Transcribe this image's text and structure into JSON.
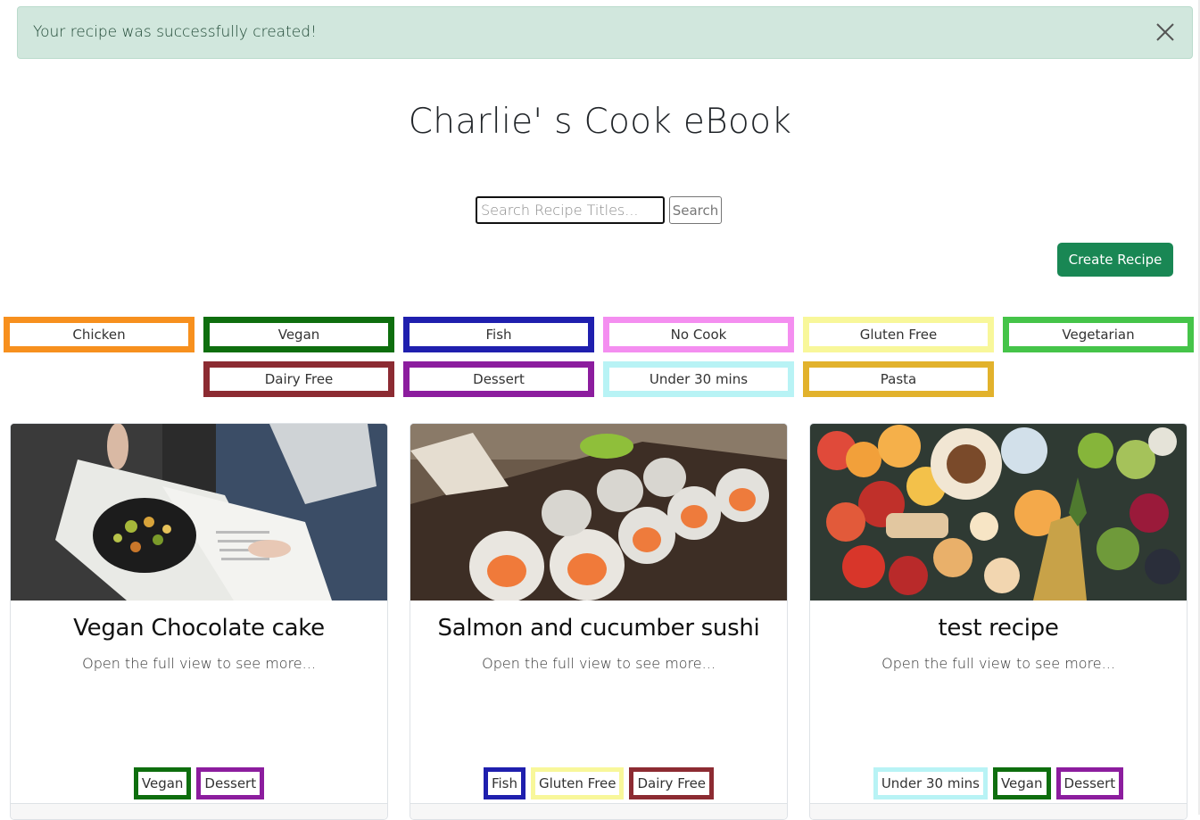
{
  "alert": {
    "message": "Your recipe was successfully created!"
  },
  "header": {
    "title": "Charlie' s Cook eBook"
  },
  "search": {
    "placeholder": "Search Recipe Titles...",
    "button_label": "Search"
  },
  "actions": {
    "create_label": "Create Recipe"
  },
  "tags": [
    {
      "label": "Chicken",
      "color": "#f7901e"
    },
    {
      "label": "Vegan",
      "color": "#0e6e0e"
    },
    {
      "label": "Fish",
      "color": "#1f1fae"
    },
    {
      "label": "No Cook",
      "color": "#f48ef0"
    },
    {
      "label": "Gluten Free",
      "color": "#f8f79a"
    },
    {
      "label": "Vegetarian",
      "color": "#45c449"
    },
    {
      "label": "Dairy Free",
      "color": "#8c2b32"
    },
    {
      "label": "Dessert",
      "color": "#8c1d9e"
    },
    {
      "label": "Under 30 mins",
      "color": "#b8f3f5"
    },
    {
      "label": "Pasta",
      "color": "#e2b22c"
    }
  ],
  "recipes": [
    {
      "title": "Vegan Chocolate cake",
      "description": "Open the full view to see more...",
      "tags": [
        {
          "label": "Vegan",
          "color": "#0e6e0e"
        },
        {
          "label": "Dessert",
          "color": "#8c1d9e"
        }
      ]
    },
    {
      "title": "Salmon and cucumber sushi",
      "description": "Open the full view to see more...",
      "tags": [
        {
          "label": "Fish",
          "color": "#1f1fae"
        },
        {
          "label": "Gluten Free",
          "color": "#f8f79a"
        },
        {
          "label": "Dairy Free",
          "color": "#8c2b32"
        }
      ]
    },
    {
      "title": "test recipe",
      "description": "Open the full view to see more...",
      "tags": [
        {
          "label": "Under 30 mins",
          "color": "#b8f3f5"
        },
        {
          "label": "Vegan",
          "color": "#0e6e0e"
        },
        {
          "label": "Dessert",
          "color": "#8c1d9e"
        }
      ]
    }
  ]
}
